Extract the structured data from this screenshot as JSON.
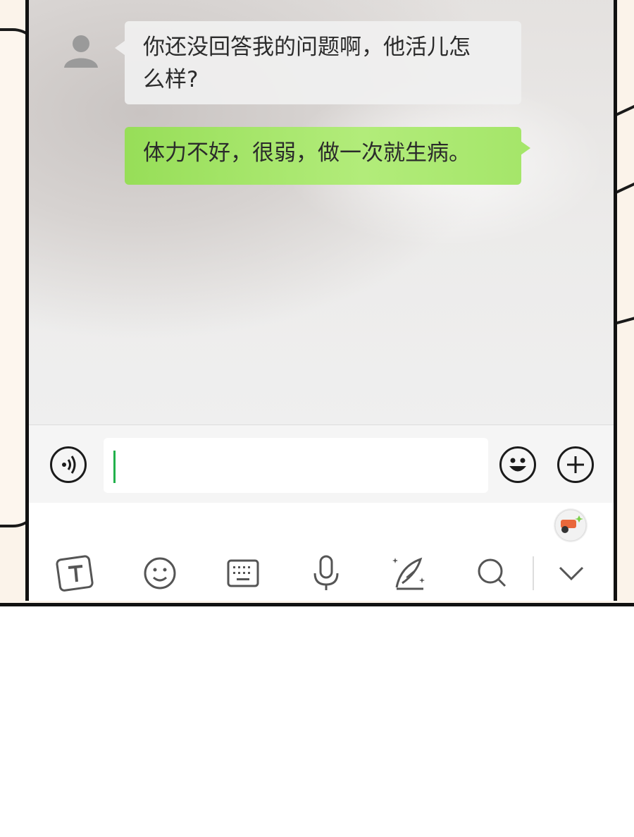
{
  "chat": {
    "messages": [
      {
        "side": "left",
        "text_line1": "你还没回答我的问题啊，他活儿怎",
        "text_line2": "么样?"
      },
      {
        "side": "right",
        "text": "体力不好，很弱，做一次就生病。"
      }
    ]
  },
  "input": {
    "value": "",
    "accent_color": "#22b14c"
  },
  "icons": {
    "avatar": "person-icon",
    "voice": "voice-icon",
    "emoji": "emoji-icon",
    "plus": "plus-icon",
    "sticker": "sticker-icon",
    "toolbar": [
      "text-style-icon",
      "smiley-icon",
      "keyboard-icon",
      "microphone-icon",
      "quill-icon",
      "search-icon",
      "chevron-down-icon"
    ]
  },
  "colors": {
    "sent_bubble": "#a5e66a",
    "received_bubble": "#f0f0f0"
  }
}
